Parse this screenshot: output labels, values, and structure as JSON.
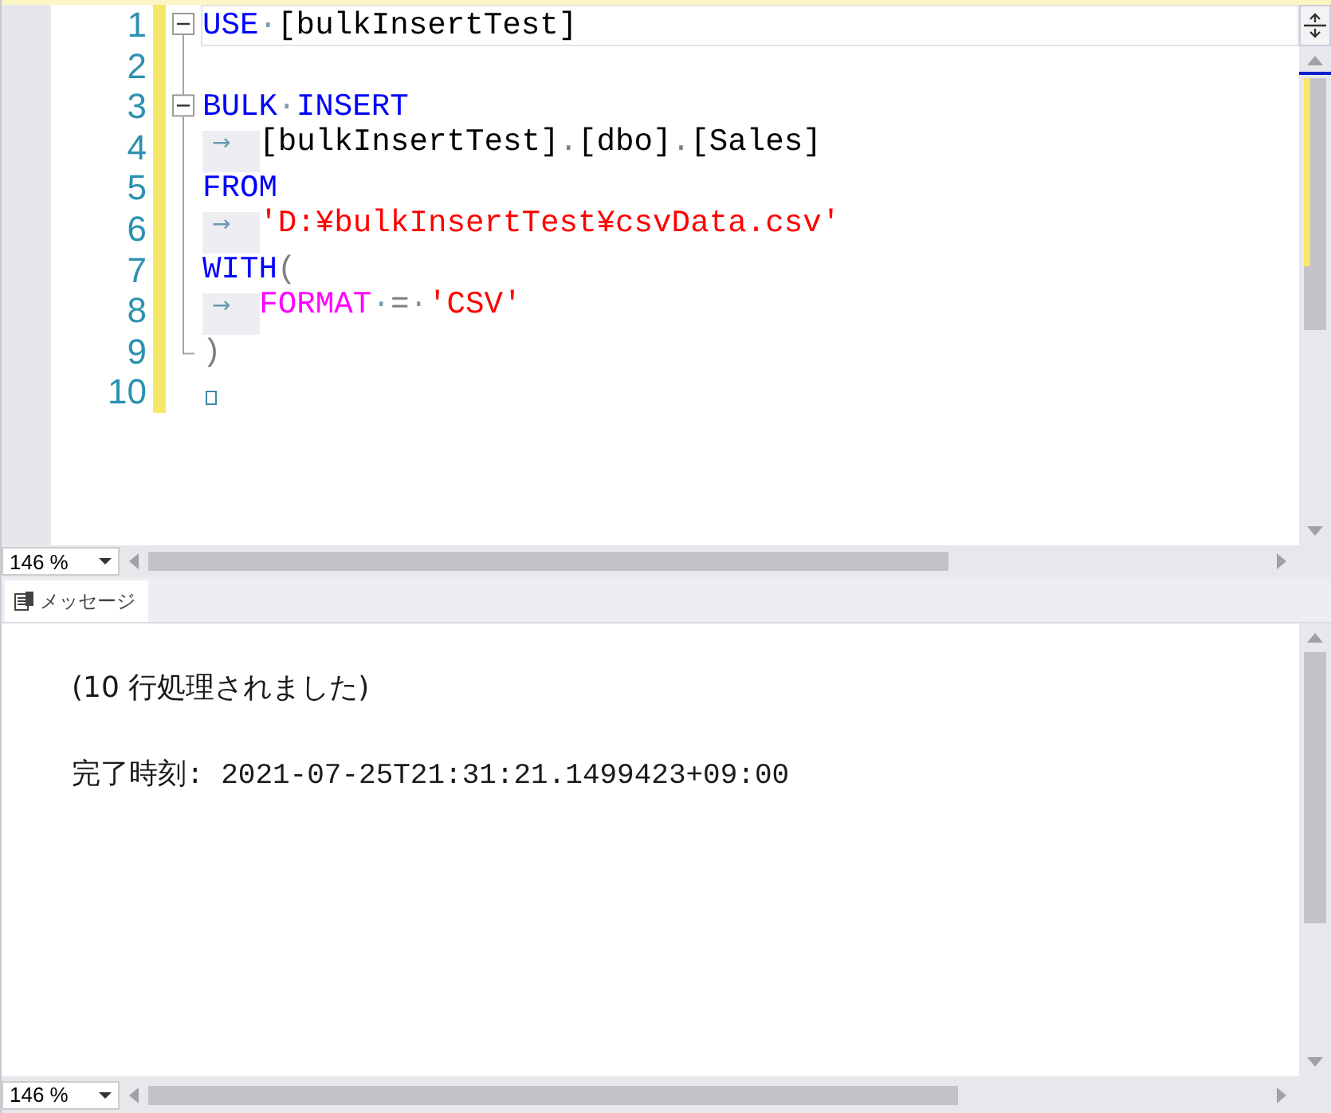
{
  "editor": {
    "lines": [
      {
        "number": "1",
        "kind": "fold-start",
        "current": true,
        "tokens": [
          {
            "kind": "keyword",
            "text": "USE"
          },
          {
            "kind": "ws",
            "text": "·"
          },
          {
            "kind": "ident",
            "text": "[bulkInsertTest]"
          }
        ]
      },
      {
        "number": "2",
        "kind": "fold-inner",
        "current": false
      },
      {
        "number": "3",
        "kind": "fold-start",
        "current": false,
        "tokens": [
          {
            "kind": "keyword",
            "text": "BULK"
          },
          {
            "kind": "ws",
            "text": "·"
          },
          {
            "kind": "keyword",
            "text": "INSERT"
          }
        ]
      },
      {
        "number": "4",
        "kind": "fold-inner",
        "current": false,
        "tokens": [
          {
            "kind": "tab",
            "text": "→"
          },
          {
            "kind": "ident",
            "text": "[bulkInsertTest]"
          },
          {
            "kind": "punct",
            "text": "."
          },
          {
            "kind": "ident",
            "text": "[dbo]"
          },
          {
            "kind": "punct",
            "text": "."
          },
          {
            "kind": "ident",
            "text": "[Sales]"
          }
        ]
      },
      {
        "number": "5",
        "kind": "fold-inner",
        "current": false,
        "tokens": [
          {
            "kind": "keyword",
            "text": "FROM"
          }
        ]
      },
      {
        "number": "6",
        "kind": "fold-inner",
        "current": false,
        "tokens": [
          {
            "kind": "tab",
            "text": "→"
          },
          {
            "kind": "string",
            "text": "'D:¥bulkInsertTest¥csvData.csv'"
          }
        ]
      },
      {
        "number": "7",
        "kind": "fold-inner",
        "current": false,
        "tokens": [
          {
            "kind": "keyword",
            "text": "WITH"
          },
          {
            "kind": "punct",
            "text": "("
          }
        ]
      },
      {
        "number": "8",
        "kind": "fold-inner",
        "current": false,
        "tokens": [
          {
            "kind": "tab",
            "text": "→"
          },
          {
            "kind": "func",
            "text": "FORMAT"
          },
          {
            "kind": "ws",
            "text": "·"
          },
          {
            "kind": "punct",
            "text": "="
          },
          {
            "kind": "ws",
            "text": "·"
          },
          {
            "kind": "string",
            "text": "'CSV'"
          }
        ]
      },
      {
        "number": "9",
        "kind": "fold-end",
        "current": false,
        "tokens": [
          {
            "kind": "punct",
            "text": ")"
          }
        ]
      },
      {
        "number": "10",
        "kind": "plain",
        "current": false,
        "tokens": [
          {
            "kind": "eof"
          }
        ]
      }
    ],
    "zoom": "146 %"
  },
  "results": {
    "tabs": [
      {
        "label": "メッセージ",
        "selected": true
      }
    ],
    "messages": [
      "(10 行処理されました)",
      "完了時刻: 2021-07-25T21:31:21.1499423+09:00"
    ],
    "zoom": "146 %"
  }
}
